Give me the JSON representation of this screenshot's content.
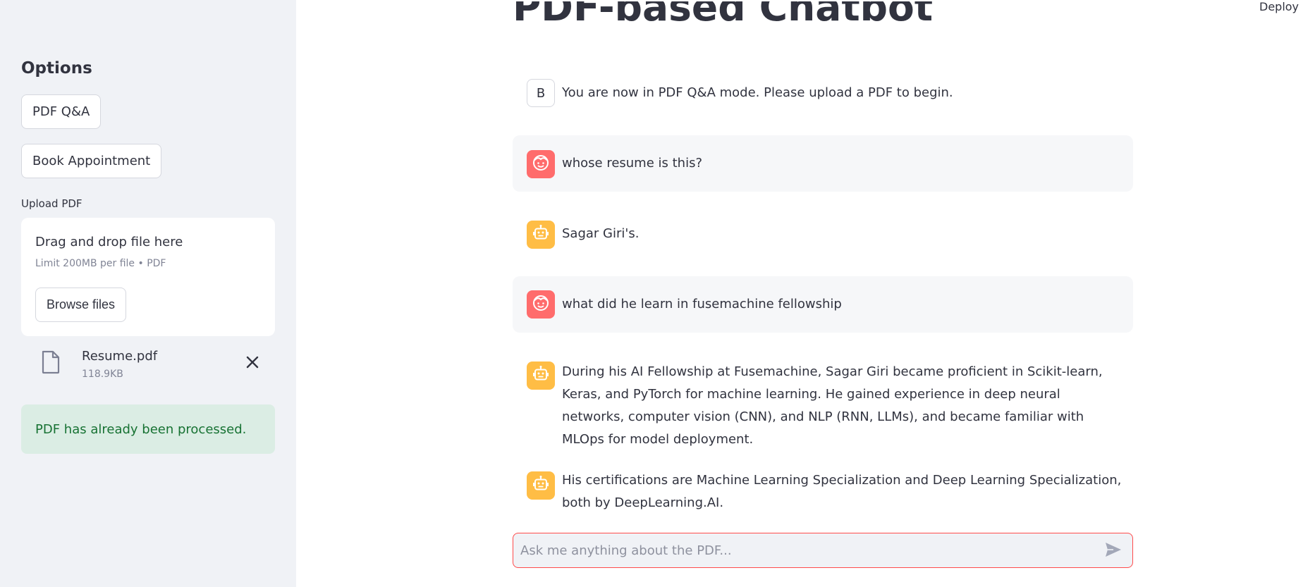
{
  "header": {
    "deploy_label": "Deploy"
  },
  "sidebar": {
    "title": "Options",
    "pdf_qa_label": "PDF Q&A",
    "book_appointment_label": "Book Appointment",
    "upload_label": "Upload PDF",
    "dropzone": {
      "title": "Drag and drop file here",
      "limit": "Limit 200MB per file • PDF",
      "browse_label": "Browse files"
    },
    "file": {
      "name": "Resume.pdf",
      "size": "118.9KB"
    },
    "status": "PDF has already been processed."
  },
  "main": {
    "title": "PDF-based Chatbot",
    "messages": [
      {
        "role": "assistant",
        "avatar": "B",
        "text": "You are now in PDF Q&A mode. Please upload a PDF to begin."
      },
      {
        "role": "user",
        "avatar_icon": "user-face-icon",
        "text": "whose resume is this?"
      },
      {
        "role": "assistant",
        "avatar_icon": "robot-icon",
        "text": "Sagar Giri's."
      },
      {
        "role": "user",
        "avatar_icon": "user-face-icon",
        "text": "what did he learn in fusemachine fellowship"
      },
      {
        "role": "assistant",
        "avatar_icon": "robot-icon",
        "text": "During his AI Fellowship at Fusemachine, Sagar Giri became proficient in Scikit-learn, Keras, and PyTorch for machine learning. He gained experience in deep neural networks, computer vision (CNN), and NLP (RNN, LLMs), and became familiar with MLOps for model deployment."
      },
      {
        "role": "assistant",
        "avatar_icon": "robot-icon",
        "text": "His certifications are Machine Learning Specialization and Deep Learning Specialization, both by DeepLearning.AI."
      }
    ],
    "chat_input": {
      "placeholder": "Ask me anything about the PDF...",
      "value": ""
    }
  },
  "colors": {
    "sidebar_bg": "#f0f2f6",
    "user_avatar": "#ff6c6c",
    "bot_avatar": "#ffbd45",
    "success_bg": "#dbede4",
    "success_text": "#177233",
    "accent": "#ff4b4b"
  }
}
